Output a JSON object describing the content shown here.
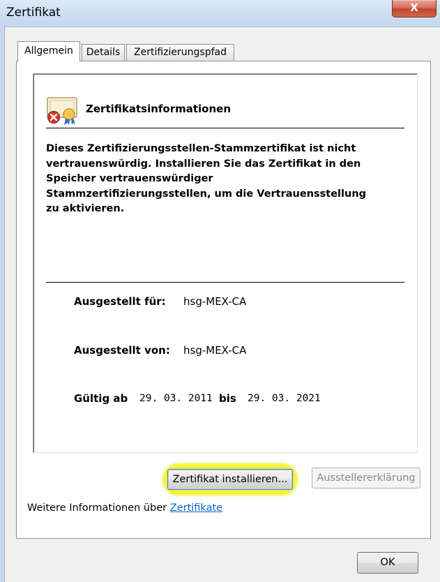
{
  "window": {
    "title": "Zertifikat",
    "close_label": "X"
  },
  "tabs": [
    {
      "label": "Allgemein",
      "active": true
    },
    {
      "label": "Details",
      "active": false
    },
    {
      "label": "Zertifizierungspfad",
      "active": false
    }
  ],
  "info": {
    "heading": "Zertifikatsinformationen",
    "warning_lines": [
      "Dieses Zertifizierungsstellen-Stammzertifikat ist nicht",
      "vertrauenswürdig. Installieren Sie das Zertifikat in den",
      "Speicher vertrauenswürdiger",
      "Stammzertifizierungsstellen, um die Vertrauensstellung",
      "zu aktivieren."
    ],
    "issued_to_label": "Ausgestellt für:",
    "issued_to_value": "hsg-MEX-CA",
    "issued_by_label": "Ausgestellt von:",
    "issued_by_value": "hsg-MEX-CA",
    "valid_from_label": "Gültig ab",
    "valid_from_value": "29. 03. 2011",
    "valid_to_label": "bis",
    "valid_to_value": "29. 03. 2021"
  },
  "buttons": {
    "install": "Zertifikat installieren...",
    "issuer_statement": "Ausstellererklärung",
    "ok": "OK"
  },
  "more_info": {
    "text": "Weitere Informationen über",
    "link": "Zertifikate"
  },
  "colors": {
    "highlight": "#f2f23a",
    "link": "#0066cc",
    "titlebar": "#cfe0f2",
    "close": "#c2432b"
  }
}
